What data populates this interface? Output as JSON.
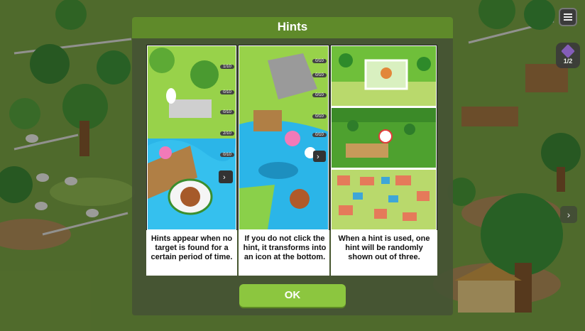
{
  "modal": {
    "title": "Hints",
    "ok_label": "OK"
  },
  "hint_panels": [
    {
      "caption": "Hints appear when no target is found for a certain period of time.",
      "counters": [
        "1/10",
        "0/10",
        "0/10",
        "2/10",
        "0/10"
      ]
    },
    {
      "caption": "If you do not click the hint, it transforms into an icon at the bottom.",
      "counters": [
        "0/10",
        "0/10",
        "0/10",
        "0/10",
        "0/10"
      ]
    },
    {
      "caption": "When a hint is used, one hint will be randomly shown out of three."
    }
  ],
  "hud": {
    "gem_counter": "1/2"
  },
  "colors": {
    "header": "#5f8a2a",
    "ok_button": "#8cc63f",
    "water": "#2bb5e8",
    "grass": "#9fd34a"
  }
}
